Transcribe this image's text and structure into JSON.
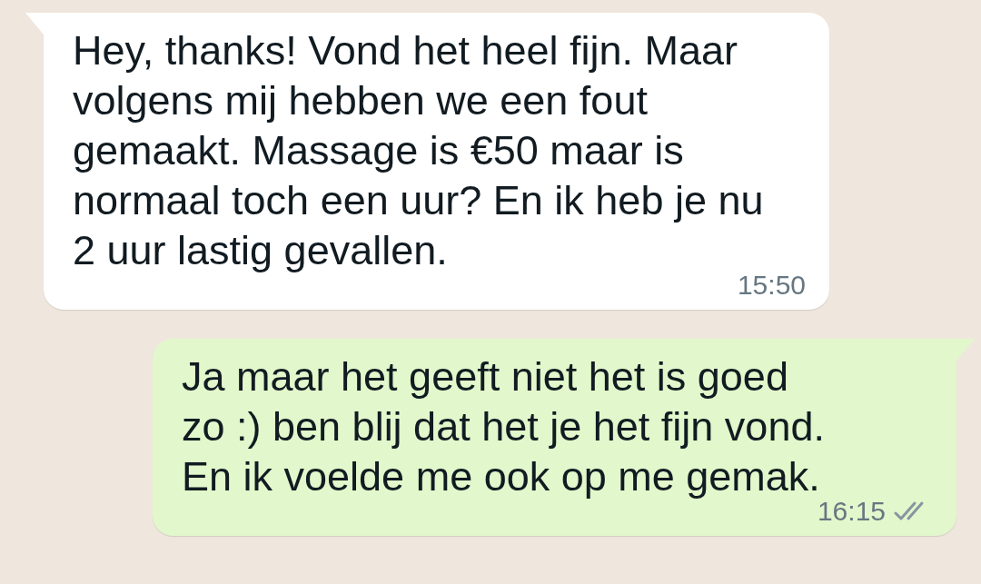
{
  "messages": [
    {
      "kind": "incoming",
      "text": "Hey, thanks! Vond het heel fijn. Maar\nvolgens mij hebben we een fout\ngemaakt. Massage is €50 maar is\nnormaal toch een uur? En ik heb je nu\n2 uur lastig gevallen.",
      "time": "15:50"
    },
    {
      "kind": "outgoing",
      "text": "Ja maar het geeft niet het is goed\nzo :) ben blij dat het je het fijn vond.\nEn ik voelde me ook op me gemak.",
      "time": "16:15",
      "read": false
    }
  ]
}
